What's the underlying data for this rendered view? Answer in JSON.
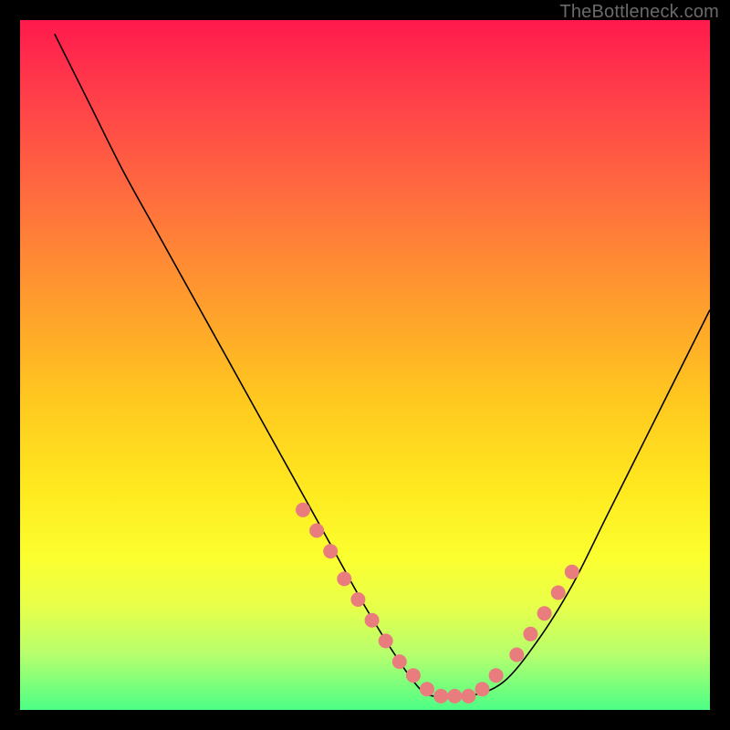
{
  "watermark": "TheBottleneck.com",
  "chart_data": {
    "type": "line",
    "title": "",
    "xlabel": "",
    "ylabel": "",
    "xlim": [
      0,
      100
    ],
    "ylim": [
      0,
      100
    ],
    "series": [
      {
        "name": "bottleneck-curve",
        "x": [
          5,
          10,
          15,
          20,
          25,
          30,
          35,
          40,
          45,
          50,
          55,
          58,
          60,
          65,
          70,
          75,
          80,
          85,
          90,
          95,
          100
        ],
        "y": [
          98,
          88,
          78,
          69,
          60,
          51,
          42,
          33,
          24,
          15,
          7,
          3,
          2,
          2,
          4,
          10,
          18,
          28,
          38,
          48,
          58
        ]
      }
    ],
    "markers": {
      "name": "highlight-dots",
      "color": "#e97d7d",
      "points": [
        {
          "x": 41,
          "y": 29
        },
        {
          "x": 43,
          "y": 26
        },
        {
          "x": 45,
          "y": 23
        },
        {
          "x": 47,
          "y": 19
        },
        {
          "x": 49,
          "y": 16
        },
        {
          "x": 51,
          "y": 13
        },
        {
          "x": 53,
          "y": 10
        },
        {
          "x": 55,
          "y": 7
        },
        {
          "x": 57,
          "y": 5
        },
        {
          "x": 59,
          "y": 3
        },
        {
          "x": 61,
          "y": 2
        },
        {
          "x": 63,
          "y": 2
        },
        {
          "x": 65,
          "y": 2
        },
        {
          "x": 67,
          "y": 3
        },
        {
          "x": 69,
          "y": 5
        },
        {
          "x": 72,
          "y": 8
        },
        {
          "x": 74,
          "y": 11
        },
        {
          "x": 76,
          "y": 14
        },
        {
          "x": 78,
          "y": 17
        },
        {
          "x": 80,
          "y": 20
        }
      ]
    },
    "background_gradient": {
      "top": "#ff1a4d",
      "bottom": "#4cff86"
    }
  }
}
